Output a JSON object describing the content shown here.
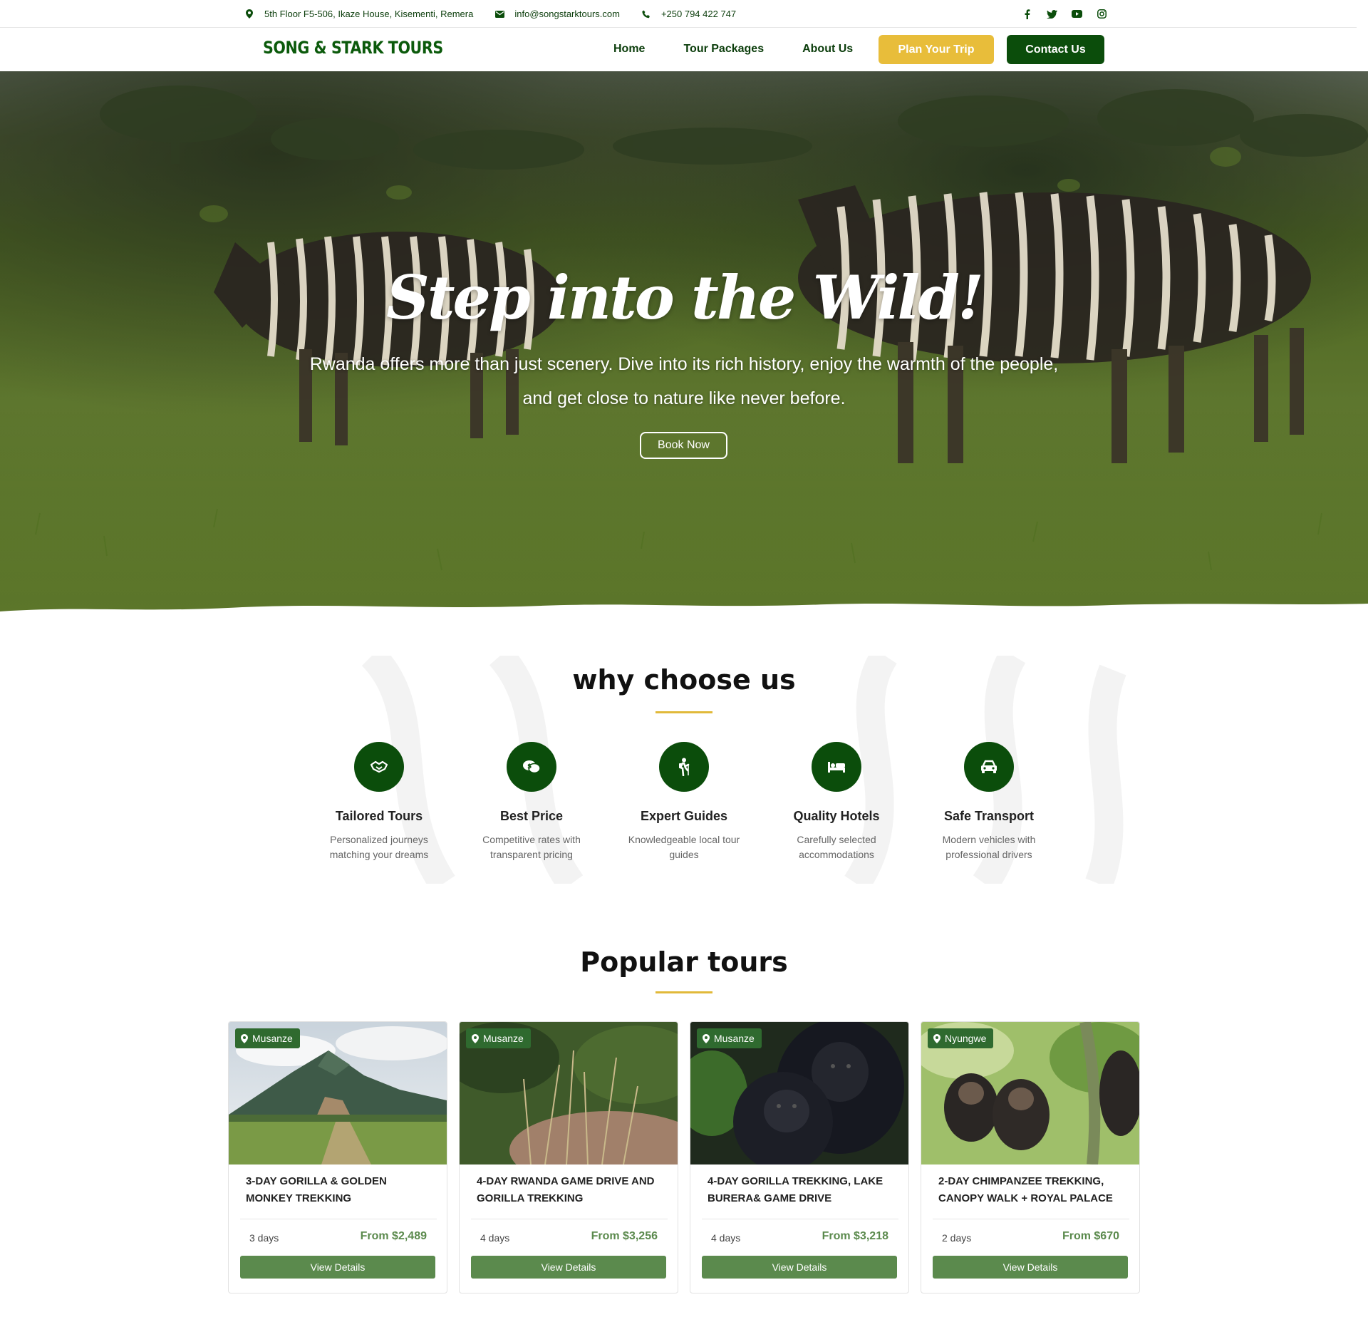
{
  "topbar": {
    "address": "5th Floor F5-506, Ikaze House, Kisementi, Remera",
    "email": "info@songstarktours.com",
    "phone": "+250 794 422 747",
    "social": [
      "facebook-icon",
      "twitter-icon",
      "youtube-icon",
      "instagram-icon"
    ]
  },
  "nav": {
    "logo": "SONG & STARK TOURS",
    "links": [
      "Home",
      "Tour Packages",
      "About Us"
    ],
    "plan_label": "Plan Your Trip",
    "contact_label": "Contact Us"
  },
  "hero": {
    "headline": "Step into the Wild!",
    "subtitle": "Rwanda offers more than just scenery. Dive into its rich history, enjoy the warmth of the people, and get close to nature like never before.",
    "cta": "Book Now"
  },
  "why": {
    "title": "why choose us",
    "features": [
      {
        "icon": "handshake-icon",
        "title": "Tailored Tours",
        "text": "Personalized journeys matching your dreams"
      },
      {
        "icon": "price-icon",
        "title": "Best Price",
        "text": "Competitive rates with transparent pricing"
      },
      {
        "icon": "hiker-icon",
        "title": "Expert Guides",
        "text": "Knowledgeable local tour guides"
      },
      {
        "icon": "bed-icon",
        "title": "Quality Hotels",
        "text": "Carefully selected accommodations"
      },
      {
        "icon": "car-icon",
        "title": "Safe Transport",
        "text": "Modern vehicles with professional drivers"
      }
    ]
  },
  "tours": {
    "title": "Popular tours",
    "cards": [
      {
        "location": "Musanze",
        "title": "3-Day Gorilla & Golden Monkey Trekking",
        "days": "3 days",
        "price": "From $2,489",
        "button": "View Details"
      },
      {
        "location": "Musanze",
        "title": "4-Day Rwanda Game Drive and Gorilla Trekking",
        "days": "4 days",
        "price": "From $3,256",
        "button": "View Details"
      },
      {
        "location": "Musanze",
        "title": "4-Day Gorilla Trekking, Lake Burera& Game Drive",
        "days": "4 days",
        "price": "From $3,218",
        "button": "View Details"
      },
      {
        "location": "Nyungwe",
        "title": "2-Day Chimpanzee Trekking, Canopy Walk + Royal Palace",
        "days": "2 days",
        "price": "From $670",
        "button": "View Details"
      }
    ]
  },
  "colors": {
    "brand_green": "#0b4d0b",
    "accent_gold": "#e8bd3a",
    "card_green": "#5b8a4d"
  }
}
